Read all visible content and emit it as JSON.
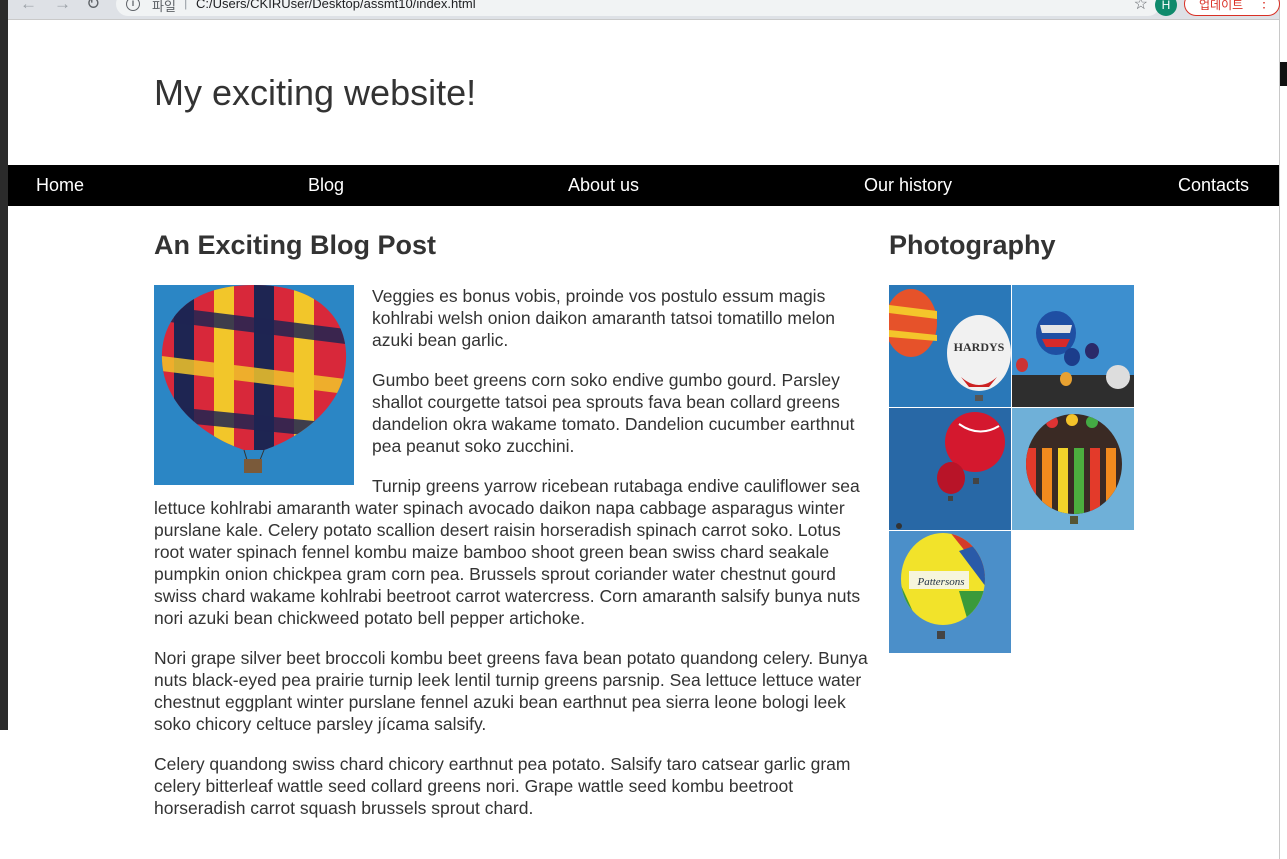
{
  "browser": {
    "url_scheme": "파일",
    "url": "C:/Users/CKIRUser/Desktop/assmt10/index.html",
    "profile_initial": "H",
    "update_label": "업데이트",
    "back_icon": "arrow-left-icon",
    "forward_icon": "arrow-right-icon",
    "reload_icon": "reload-icon",
    "info_icon": "info-icon",
    "bookmark_icon": "star-icon",
    "menu_icon": "more-vert-icon"
  },
  "site": {
    "title": "My exciting website!"
  },
  "nav": {
    "items": [
      {
        "label": "Home"
      },
      {
        "label": "Blog"
      },
      {
        "label": "About us"
      },
      {
        "label": "Our history"
      },
      {
        "label": "Contacts"
      }
    ]
  },
  "post": {
    "title": "An Exciting Blog Post",
    "paragraphs": [
      "Veggies es bonus vobis, proinde vos postulo essum magis kohlrabi welsh onion daikon amaranth tatsoi tomatillo melon azuki bean garlic.",
      "Gumbo beet greens corn soko endive gumbo gourd. Parsley shallot courgette tatsoi pea sprouts fava bean collard greens dandelion okra wakame tomato. Dandelion cucumber earthnut pea peanut soko zucchini.",
      "Turnip greens yarrow ricebean rutabaga endive cauliflower sea lettuce kohlrabi amaranth water spinach avocado daikon napa cabbage asparagus winter purslane kale. Celery potato scallion desert raisin horseradish spinach carrot soko. Lotus root water spinach fennel kombu maize bamboo shoot green bean swiss chard seakale pumpkin onion chickpea gram corn pea. Brussels sprout coriander water chestnut gourd swiss chard wakame kohlrabi beetroot carrot watercress. Corn amaranth salsify bunya nuts nori azuki bean chickweed potato bell pepper artichoke.",
      "Nori grape silver beet broccoli kombu beet greens fava bean potato quandong celery. Bunya nuts black-eyed pea prairie turnip leek lentil turnip greens parsnip. Sea lettuce lettuce water chestnut eggplant winter purslane fennel azuki bean earthnut pea sierra leone bologi leek soko chicory celtuce parsley jícama salsify.",
      "Celery quandong swiss chard chicory earthnut pea potato. Salsify taro catsear garlic gram celery bitterleaf wattle seed collard greens nori. Grape wattle seed kombu beetroot horseradish carrot squash brussels sprout chard."
    ]
  },
  "sidebar": {
    "title": "Photography",
    "balloon_texts": [
      "HARDYS",
      "Pattersons"
    ]
  }
}
